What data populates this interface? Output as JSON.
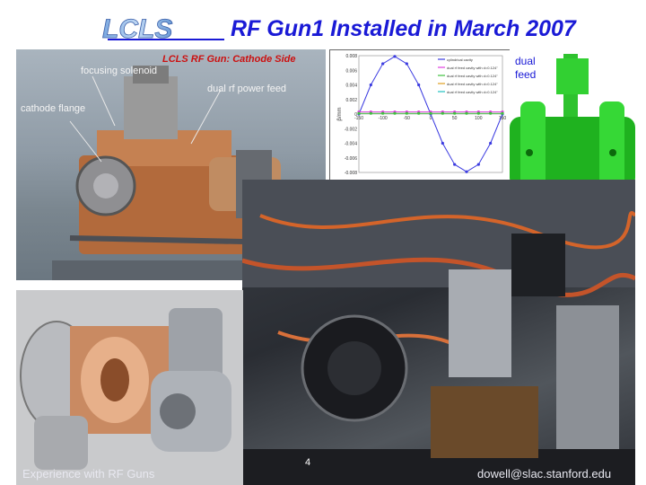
{
  "header": {
    "title": "RF Gun1 Installed in March 2007",
    "logo_text": "LCLS"
  },
  "photo_top": {
    "caption": "LCLS RF Gun: Cathode Side",
    "labels": {
      "focusing_solenoid": "focusing solenoid",
      "dual_feed": "dual rf power feed",
      "cathode_flange": "cathode flange"
    }
  },
  "chart": {
    "ylabel": "β/mm",
    "xlabel": "r/mm",
    "legend": [
      "cylindrical cavity",
      "dual rf feed cavity with d=0.124\"",
      "dual rf feed cavity with d=0.124\"",
      "dual rf feed cavity with d=0.124\"",
      "dual rf feed cavity with d=0.124\""
    ],
    "yticks": [
      "0.008",
      "0.006",
      "0.004",
      "0.002",
      "0",
      "-0.002",
      "-0.004",
      "-0.006",
      "-0.008"
    ],
    "xticks": [
      "-150",
      "-100",
      "-50",
      "0",
      "50",
      "100",
      "150"
    ],
    "colors": [
      "#3a3ae0",
      "#e040e0",
      "#40c040",
      "#e0a020",
      "#20c0c0"
    ]
  },
  "chart_data": {
    "type": "line",
    "title": "",
    "xlabel": "r/mm",
    "ylabel": "β/mm",
    "xlim": [
      -150,
      150
    ],
    "ylim": [
      -0.008,
      0.008
    ],
    "x": [
      -150,
      -125,
      -100,
      -75,
      -50,
      -25,
      0,
      25,
      50,
      75,
      100,
      125,
      150
    ],
    "series": [
      {
        "name": "cylindrical cavity",
        "values": [
          0.0,
          0.004,
          0.0069,
          0.0079,
          0.0069,
          0.004,
          0.0,
          -0.004,
          -0.0069,
          -0.0079,
          -0.0069,
          -0.004,
          0.0
        ]
      },
      {
        "name": "dual rf feed cavity with d=0.124\"",
        "values": [
          0.0003,
          0.0003,
          0.0003,
          0.0003,
          0.0003,
          0.0003,
          0.0003,
          0.0003,
          0.0003,
          0.0003,
          0.0003,
          0.0003,
          0.0003
        ]
      },
      {
        "name": "dual rf feed cavity with d=0.124\"",
        "values": [
          0.0001,
          0.0001,
          0.0001,
          0.0001,
          0.0001,
          0.0001,
          0.0001,
          0.0001,
          0.0001,
          0.0001,
          0.0001,
          0.0001,
          0.0001
        ]
      }
    ]
  },
  "dual_box": {
    "label_line1": "dual",
    "label_line2": "feed"
  },
  "footer": {
    "left": "Experience with RF Guns",
    "page": "4",
    "right": "dowell@slac.stanford.edu"
  }
}
